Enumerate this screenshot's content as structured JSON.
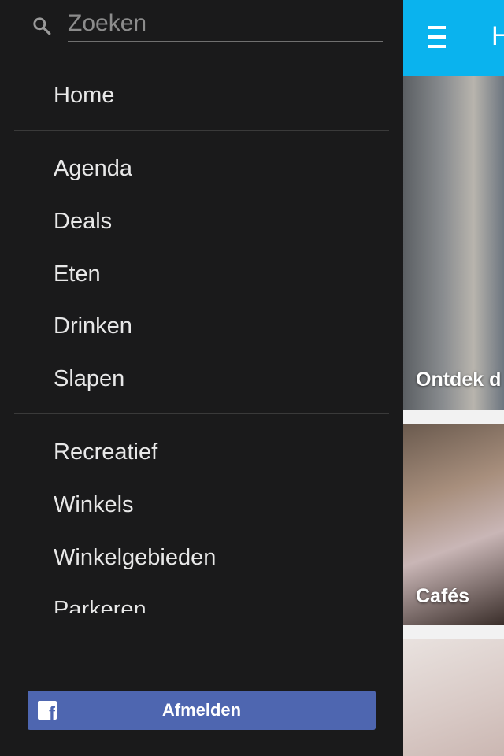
{
  "search": {
    "placeholder": "Zoeken",
    "value": ""
  },
  "nav": {
    "home": "Home",
    "group1": [
      "Agenda",
      "Deals",
      "Eten",
      "Drinken",
      "Slapen"
    ],
    "group2": [
      "Recreatief",
      "Winkels",
      "Winkelgebieden",
      "Parkeren"
    ]
  },
  "footer": {
    "logout_label": "Afmelden",
    "fb_glyph": "f"
  },
  "background_app": {
    "title": "H",
    "cards": [
      "Ontdek d",
      "Cafés",
      ""
    ]
  },
  "colors": {
    "appbar": "#0ab3ee",
    "drawer": "#1a1a1b",
    "facebook": "#4e66b0"
  }
}
